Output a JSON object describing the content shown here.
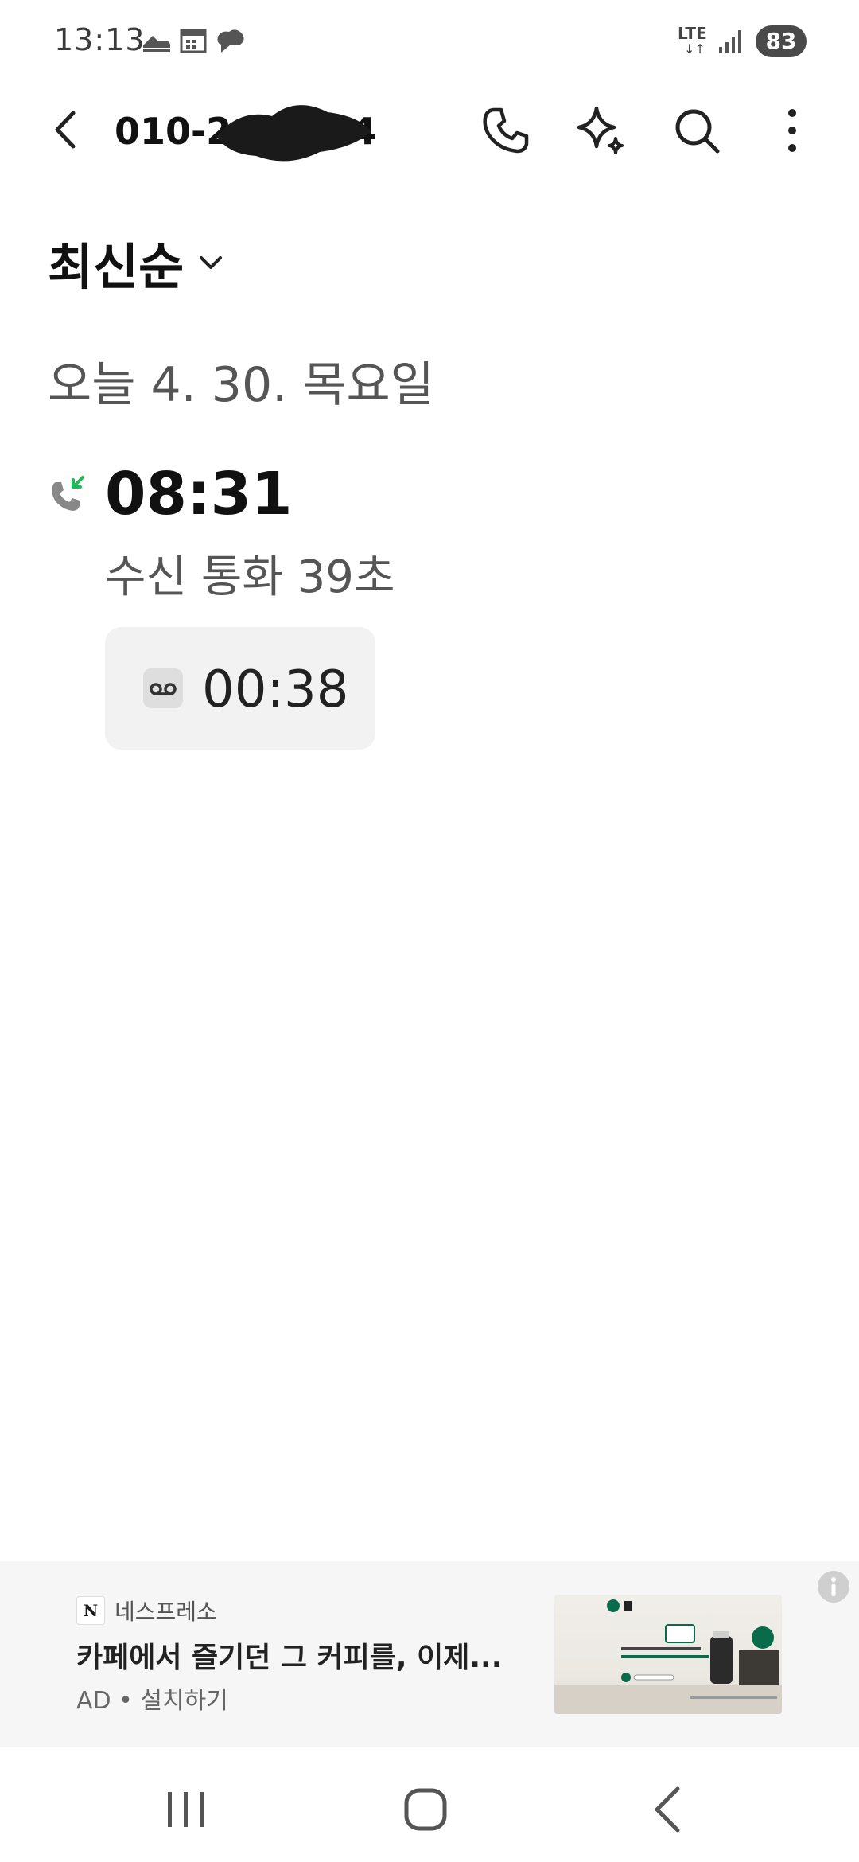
{
  "status_bar": {
    "time": "13:13",
    "network": "LTE",
    "battery": "83",
    "left_icons": [
      "shoe-icon",
      "calendar-icon",
      "cloud-icon"
    ]
  },
  "app_bar": {
    "phone_number": "010-2",
    "phone_number_end": "4",
    "actions": [
      "phone-icon",
      "ai-sparkle-icon",
      "search-icon",
      "more-icon"
    ]
  },
  "sort": {
    "label": "최신순"
  },
  "call_log": {
    "date_header": "오늘 4. 30. 목요일",
    "entries": [
      {
        "time": "08:31",
        "description": "수신 통화 39초",
        "voicemail_duration": "00:38",
        "type": "incoming",
        "accent": "#1db954"
      }
    ]
  },
  "ad": {
    "advertiser": "네스프레소",
    "logo_text": "N",
    "headline": "카페에서 즐기던 그 커피를, 이제...",
    "footer": "AD • 설치하기"
  },
  "nav": [
    "recent-apps-icon",
    "home-icon",
    "back-icon"
  ]
}
